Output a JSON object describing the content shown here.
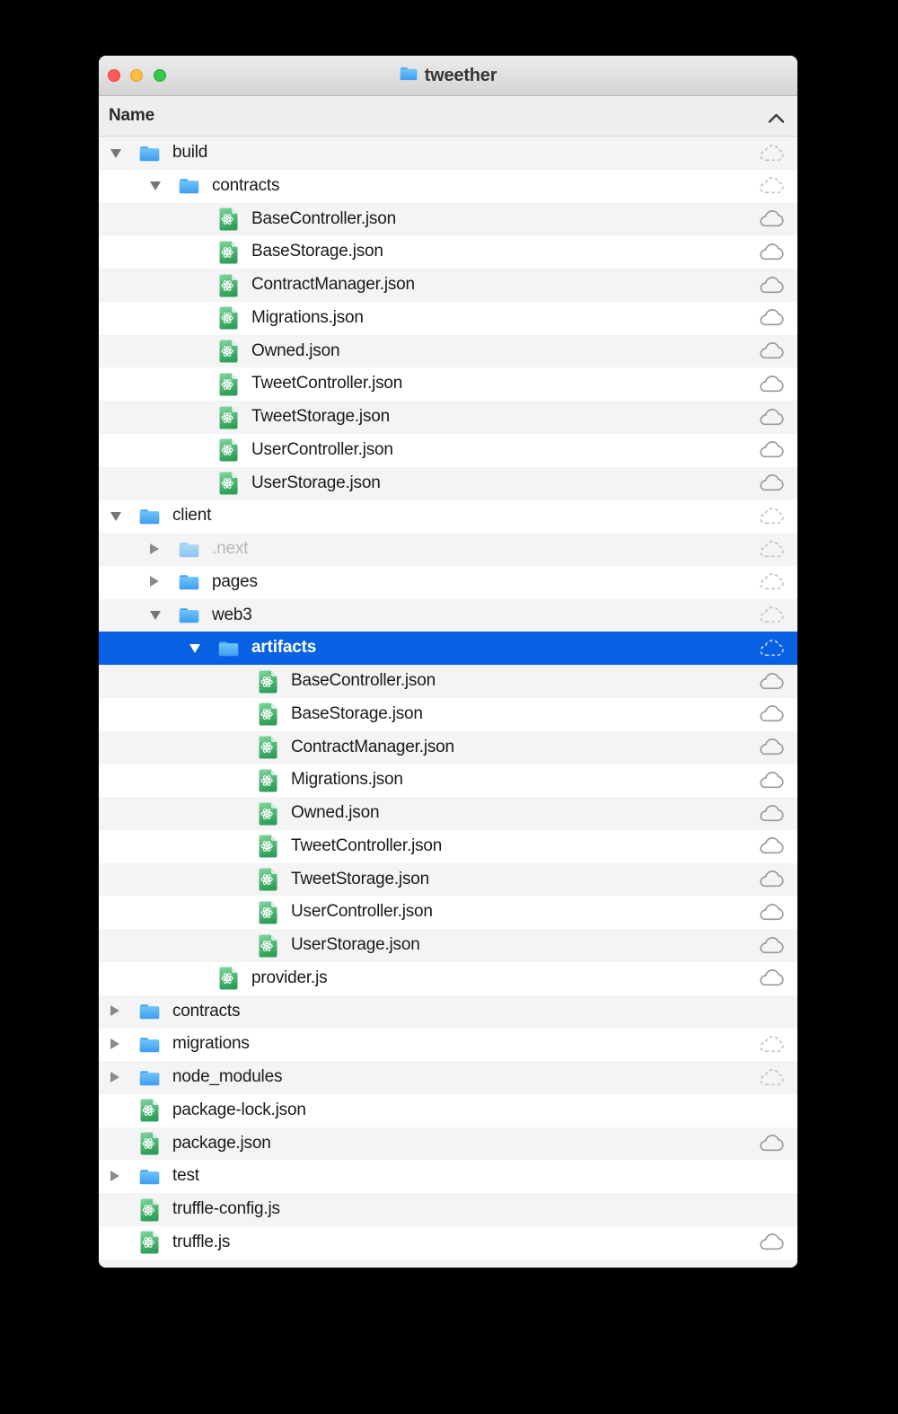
{
  "window": {
    "title": "tweether",
    "proxy_icon": "folder-icon"
  },
  "traffic_lights": [
    {
      "name": "close-button",
      "color": "#fc5b57"
    },
    {
      "name": "minimize-button",
      "color": "#fdbe41"
    },
    {
      "name": "zoom-button",
      "color": "#34c84a"
    }
  ],
  "header": {
    "name_column": "Name",
    "sort_indicator": "chevron-up-icon",
    "sort_direction": "ascending"
  },
  "icons": {
    "folder": "folder-icon",
    "file": "document-atom-icon",
    "synced": "cloud-outline-icon",
    "not_synced": "cloud-dashed-icon",
    "disclosure_open": "triangle-down-icon",
    "disclosure_closed": "triangle-right-icon"
  },
  "colors": {
    "selection_blue": "#0761e2",
    "row_stripe_gray": "#f4f4f5",
    "folder_blue": "#54aef2",
    "file_green": "#2e9f58",
    "cloud_gray": "#9a9a9c",
    "titlebar_top": "#ececec",
    "titlebar_bottom": "#d4d4d4"
  },
  "rows": [
    {
      "label": "build",
      "level": 0,
      "type": "folder",
      "disclosure": "open",
      "cloud": "dashed"
    },
    {
      "label": "contracts",
      "level": 1,
      "type": "folder",
      "disclosure": "open",
      "cloud": "dashed"
    },
    {
      "label": "BaseController.json",
      "level": 2,
      "type": "file",
      "disclosure": null,
      "cloud": "solid"
    },
    {
      "label": "BaseStorage.json",
      "level": 2,
      "type": "file",
      "disclosure": null,
      "cloud": "solid"
    },
    {
      "label": "ContractManager.json",
      "level": 2,
      "type": "file",
      "disclosure": null,
      "cloud": "solid"
    },
    {
      "label": "Migrations.json",
      "level": 2,
      "type": "file",
      "disclosure": null,
      "cloud": "solid"
    },
    {
      "label": "Owned.json",
      "level": 2,
      "type": "file",
      "disclosure": null,
      "cloud": "solid"
    },
    {
      "label": "TweetController.json",
      "level": 2,
      "type": "file",
      "disclosure": null,
      "cloud": "solid"
    },
    {
      "label": "TweetStorage.json",
      "level": 2,
      "type": "file",
      "disclosure": null,
      "cloud": "solid"
    },
    {
      "label": "UserController.json",
      "level": 2,
      "type": "file",
      "disclosure": null,
      "cloud": "solid"
    },
    {
      "label": "UserStorage.json",
      "level": 2,
      "type": "file",
      "disclosure": null,
      "cloud": "solid"
    },
    {
      "label": "client",
      "level": 0,
      "type": "folder",
      "disclosure": "open",
      "cloud": "dashed"
    },
    {
      "label": ".next",
      "level": 1,
      "type": "folder",
      "disclosure": "closed",
      "cloud": "dashed",
      "dimmed": true
    },
    {
      "label": "pages",
      "level": 1,
      "type": "folder",
      "disclosure": "closed",
      "cloud": "dashed"
    },
    {
      "label": "web3",
      "level": 1,
      "type": "folder",
      "disclosure": "open",
      "cloud": "dashed"
    },
    {
      "label": "artifacts",
      "level": 2,
      "type": "folder",
      "disclosure": "open",
      "cloud": "dashed",
      "selected": true
    },
    {
      "label": "BaseController.json",
      "level": 3,
      "type": "file",
      "disclosure": null,
      "cloud": "solid"
    },
    {
      "label": "BaseStorage.json",
      "level": 3,
      "type": "file",
      "disclosure": null,
      "cloud": "solid"
    },
    {
      "label": "ContractManager.json",
      "level": 3,
      "type": "file",
      "disclosure": null,
      "cloud": "solid"
    },
    {
      "label": "Migrations.json",
      "level": 3,
      "type": "file",
      "disclosure": null,
      "cloud": "solid"
    },
    {
      "label": "Owned.json",
      "level": 3,
      "type": "file",
      "disclosure": null,
      "cloud": "solid"
    },
    {
      "label": "TweetController.json",
      "level": 3,
      "type": "file",
      "disclosure": null,
      "cloud": "solid"
    },
    {
      "label": "TweetStorage.json",
      "level": 3,
      "type": "file",
      "disclosure": null,
      "cloud": "solid"
    },
    {
      "label": "UserController.json",
      "level": 3,
      "type": "file",
      "disclosure": null,
      "cloud": "solid"
    },
    {
      "label": "UserStorage.json",
      "level": 3,
      "type": "file",
      "disclosure": null,
      "cloud": "solid"
    },
    {
      "label": "provider.js",
      "level": 2,
      "type": "file",
      "disclosure": null,
      "cloud": "solid"
    },
    {
      "label": "contracts",
      "level": 0,
      "type": "folder",
      "disclosure": "closed",
      "cloud": "none"
    },
    {
      "label": "migrations",
      "level": 0,
      "type": "folder",
      "disclosure": "closed",
      "cloud": "dashed"
    },
    {
      "label": "node_modules",
      "level": 0,
      "type": "folder",
      "disclosure": "closed",
      "cloud": "dashed"
    },
    {
      "label": "package-lock.json",
      "level": 0,
      "type": "file",
      "disclosure": null,
      "cloud": "none"
    },
    {
      "label": "package.json",
      "level": 0,
      "type": "file",
      "disclosure": null,
      "cloud": "solid"
    },
    {
      "label": "test",
      "level": 0,
      "type": "folder",
      "disclosure": "closed",
      "cloud": "none"
    },
    {
      "label": "truffle-config.js",
      "level": 0,
      "type": "file",
      "disclosure": null,
      "cloud": "none"
    },
    {
      "label": "truffle.js",
      "level": 0,
      "type": "file",
      "disclosure": null,
      "cloud": "solid"
    }
  ]
}
